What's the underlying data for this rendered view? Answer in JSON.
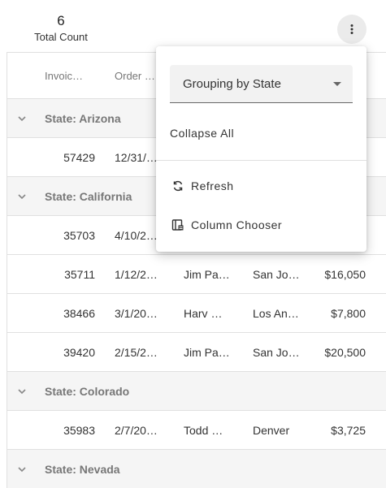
{
  "summary": {
    "count": "6",
    "label": "Total Count"
  },
  "grid": {
    "columns": [
      "Invoic…",
      "Order …"
    ],
    "groups": [
      {
        "title": "State: Arizona",
        "rows": [
          [
            "57429",
            "12/31/…",
            "",
            "",
            ""
          ]
        ]
      },
      {
        "title": "State: California",
        "rows": [
          [
            "35703",
            "4/10/2…",
            "",
            "",
            ""
          ],
          [
            "35711",
            "1/12/2…",
            "Jim Pa…",
            "San Jo…",
            "$16,050"
          ],
          [
            "38466",
            "3/1/20…",
            "Harv …",
            "Los An…",
            "$7,800"
          ],
          [
            "39420",
            "2/15/2…",
            "Jim Pa…",
            "San Jo…",
            "$20,500"
          ]
        ]
      },
      {
        "title": "State: Colorado",
        "rows": [
          [
            "35983",
            "2/7/20…",
            "Todd …",
            "Denver",
            "$3,725"
          ]
        ]
      },
      {
        "title": "State: Nevada",
        "rows": []
      }
    ]
  },
  "popup": {
    "grouping_value": "Grouping by State",
    "collapse_all": "Collapse All",
    "refresh": "Refresh",
    "column_chooser": "Column Chooser"
  },
  "icons": {
    "menu": "more-vertical-icon",
    "expand": "chevron-down-icon",
    "refresh": "refresh-icon",
    "column_chooser": "column-chooser-icon"
  }
}
